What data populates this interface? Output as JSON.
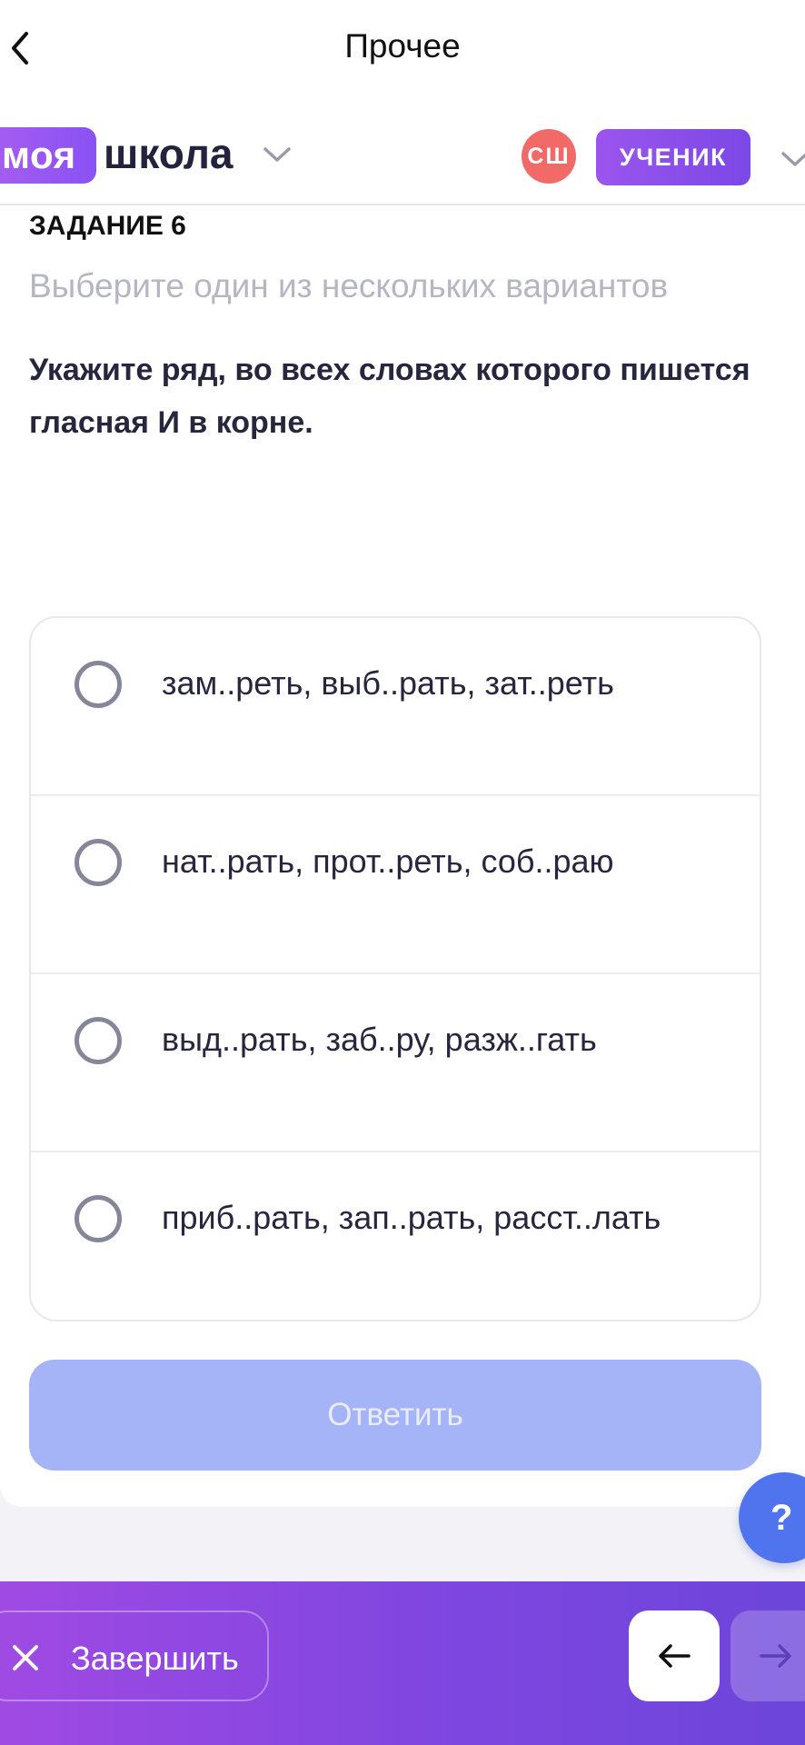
{
  "header": {
    "title": "Прочее"
  },
  "brand": {
    "logo_pill": "моя",
    "logo_text": "школа"
  },
  "user": {
    "avatar_initials": "СШ",
    "role": "УЧЕНИК"
  },
  "task": {
    "number_label": "ЗАДАНИЕ 6",
    "hint": "Выберите один из нескольких вариантов",
    "question": "Укажите ряд, во всех словах которого пишется гласная И в корне."
  },
  "options": [
    {
      "label": "зам..реть, выб..рать, зат..реть"
    },
    {
      "label": "нат..рать, прот..реть, соб..раю"
    },
    {
      "label": "выд..рать, заб..ру, разж..гать"
    },
    {
      "label": "приб..рать, зап..рать, расст..лать"
    }
  ],
  "actions": {
    "answer": "Ответить",
    "help": "?",
    "finish": "Завершить"
  },
  "icons": {
    "back": "chevron-left-icon",
    "brand_menu": "chevron-down-icon",
    "role_menu": "chevron-down-icon",
    "finish": "close-icon",
    "prev": "arrow-left-icon",
    "next": "arrow-right-icon"
  },
  "colors": {
    "accent_purple": "#8a52f4",
    "avatar_red": "#f26a68",
    "answer_disabled": "#a5b4f7",
    "help_blue": "#4f74ee"
  }
}
